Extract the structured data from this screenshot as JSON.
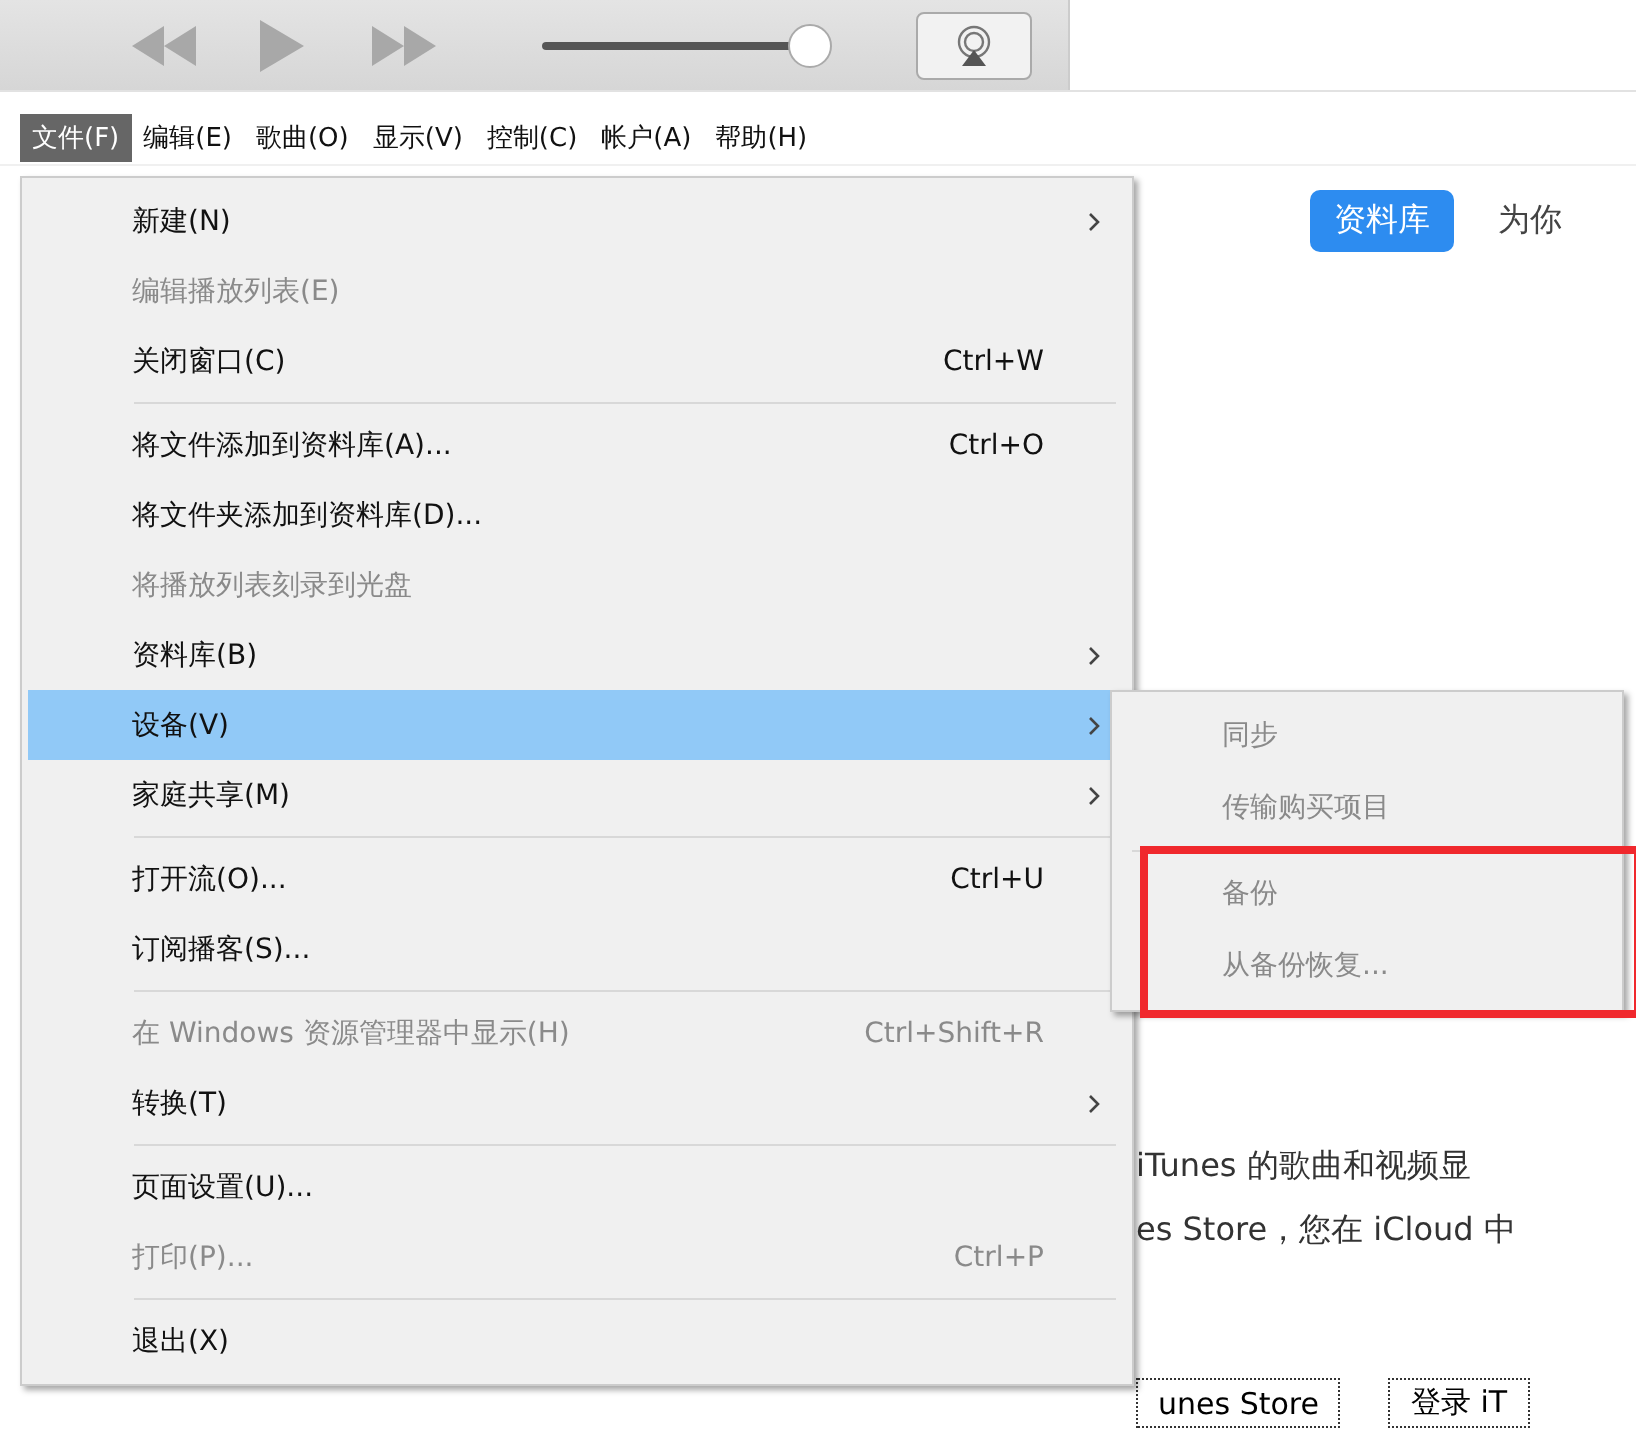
{
  "player": {
    "volume": {
      "level": 0.97
    }
  },
  "menu_bar": [
    {
      "label": "文件(F)",
      "selected": true
    },
    {
      "label": "编辑(E)",
      "selected": false
    },
    {
      "label": "歌曲(O)",
      "selected": false
    },
    {
      "label": "显示(V)",
      "selected": false
    },
    {
      "label": "控制(C)",
      "selected": false
    },
    {
      "label": "帐户(A)",
      "selected": false
    },
    {
      "label": "帮助(H)",
      "selected": false
    }
  ],
  "content": {
    "tabs": [
      {
        "label": "资料库",
        "selected": true
      },
      {
        "label": "为你",
        "selected": false
      }
    ],
    "text_lines": [
      "iTunes 的歌曲和视频显",
      "es Store，您在 iCloud 中"
    ],
    "buttons": [
      "unes Store",
      "登录 iT"
    ]
  },
  "file_menu": {
    "sections": [
      [
        {
          "label": "新建(N)",
          "disabled": false,
          "selected": false,
          "has_submenu": true
        },
        {
          "label": "编辑播放列表(E)",
          "disabled": true,
          "selected": false,
          "has_submenu": false
        },
        {
          "label": "关闭窗口(C)",
          "shortcut": "Ctrl+W",
          "disabled": false,
          "selected": false,
          "has_submenu": false
        }
      ],
      [
        {
          "label": "将文件添加到资料库(A)...",
          "shortcut": "Ctrl+O",
          "disabled": false,
          "selected": false,
          "has_submenu": false
        },
        {
          "label": "将文件夹添加到资料库(D)...",
          "disabled": false,
          "selected": false,
          "has_submenu": false
        },
        {
          "label": "将播放列表刻录到光盘",
          "disabled": true,
          "selected": false,
          "has_submenu": false
        },
        {
          "label": "资料库(B)",
          "disabled": false,
          "selected": false,
          "has_submenu": true
        },
        {
          "label": "设备(V)",
          "disabled": false,
          "selected": true,
          "has_submenu": true
        },
        {
          "label": "家庭共享(M)",
          "disabled": false,
          "selected": false,
          "has_submenu": true
        }
      ],
      [
        {
          "label": "打开流(O)...",
          "shortcut": "Ctrl+U",
          "disabled": false,
          "selected": false,
          "has_submenu": false
        },
        {
          "label": "订阅播客(S)...",
          "disabled": false,
          "selected": false,
          "has_submenu": false
        }
      ],
      [
        {
          "label": "在 Windows 资源管理器中显示(H)",
          "shortcut": "Ctrl+Shift+R",
          "disabled": true,
          "selected": false,
          "has_submenu": false
        },
        {
          "label": "转换(T)",
          "disabled": false,
          "selected": false,
          "has_submenu": true
        }
      ],
      [
        {
          "label": "页面设置(U)...",
          "disabled": false,
          "selected": false,
          "has_submenu": false
        },
        {
          "label": "打印(P)...",
          "shortcut": "Ctrl+P",
          "disabled": true,
          "selected": false,
          "has_submenu": false
        }
      ],
      [
        {
          "label": "退出(X)",
          "disabled": false,
          "selected": false,
          "has_submenu": false
        }
      ]
    ]
  },
  "device_submenu": {
    "sections": [
      {
        "items": [
          {
            "label": "同步",
            "disabled": true
          },
          {
            "label": "传输购买项目",
            "disabled": true
          }
        ]
      },
      {
        "highlighted": true,
        "items": [
          {
            "label": "备份",
            "disabled": true
          },
          {
            "label": "从备份恢复...",
            "disabled": true
          }
        ]
      }
    ]
  }
}
